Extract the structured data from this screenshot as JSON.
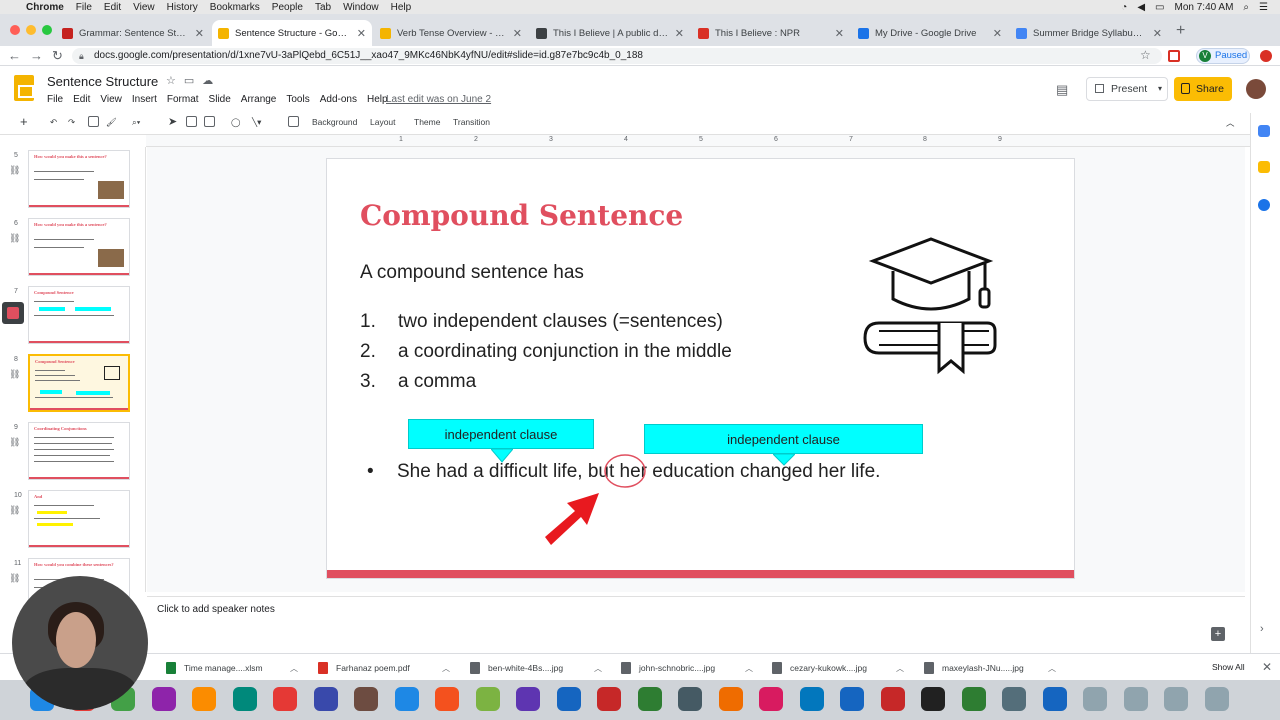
{
  "macbar": {
    "app_name": "Chrome",
    "menus": [
      "File",
      "Edit",
      "View",
      "History",
      "Bookmarks",
      "People",
      "Tab",
      "Window",
      "Help"
    ],
    "clock": "Mon 7:40 AM"
  },
  "tabs": [
    {
      "title": "Grammar: Sentence Structure",
      "color": "#c5221f"
    },
    {
      "title": "Sentence Structure - Google S",
      "color": "#f4b400"
    },
    {
      "title": "Verb Tense Overview - Google",
      "color": "#f4b400"
    },
    {
      "title": "This I Believe | A public dialog",
      "color": "#3c4043"
    },
    {
      "title": "This I Believe : NPR",
      "color": "#d93025"
    },
    {
      "title": "My Drive - Google Drive",
      "color": "#1a73e8"
    },
    {
      "title": "Summer Bridge Syllabus 2020",
      "color": "#4285f4"
    }
  ],
  "address": {
    "url": "docs.google.com/presentation/d/1xne7vU-3aPlQebd_6C51J__xao47_9MKc46NbK4yfNU/edit#slide=id.g87e7bc9c4b_0_188",
    "profile_letter": "V",
    "paused_label": "Paused"
  },
  "doc": {
    "title": "Sentence Structure",
    "menus": [
      "File",
      "Edit",
      "View",
      "Insert",
      "Format",
      "Slide",
      "Arrange",
      "Tools",
      "Add-ons",
      "Help"
    ],
    "last_edit": "Last edit was on June 2",
    "present_label": "Present",
    "share_label": "Share"
  },
  "toolbar": {
    "background": "Background",
    "layout": "Layout",
    "theme": "Theme",
    "transition": "Transition"
  },
  "ruler": [
    "1",
    "2",
    "3",
    "4",
    "5",
    "6",
    "7",
    "8",
    "9"
  ],
  "filmstrip": [
    {
      "num": "5",
      "title": "How would you make this a sentence?"
    },
    {
      "num": "6",
      "title": "How would you make this a sentence?"
    },
    {
      "num": "7",
      "title": "Compound Sentence"
    },
    {
      "num": "8",
      "title": "Compound Sentence"
    },
    {
      "num": "9",
      "title": "Coordinating Conjunctions"
    },
    {
      "num": "10",
      "title": "And"
    },
    {
      "num": "11",
      "title": "How would you combine these sentences?"
    }
  ],
  "slide": {
    "title": "Compound Sentence",
    "lead": "A compound sentence has",
    "items": [
      {
        "num": "1.",
        "text": "two independent clauses (=sentences)"
      },
      {
        "num": "2.",
        "text": "a coordinating conjunction in the middle"
      },
      {
        "num": "3.",
        "text": "a comma"
      }
    ],
    "clause_label_1": "independent clause",
    "clause_label_2": "independent clause",
    "sentence_bullet": "•",
    "sentence_part1": "She had a difficult life, ",
    "sentence_but": "but",
    "sentence_part2": " her education changed her life.",
    "accent_color": "#e04f5f"
  },
  "notes_placeholder": "Click to add speaker notes",
  "downloads": [
    {
      "name": "Time manage....xlsm",
      "color": "#188038"
    },
    {
      "name": "Farhanaz poem.pdf",
      "color": "#d93025"
    },
    {
      "name": "ben-white-4Bs....jpg",
      "color": "#5f6368"
    },
    {
      "name": "john-schnobric....jpg",
      "color": "#5f6368"
    },
    {
      "name": "cezary-kukowk....jpg",
      "color": "#5f6368"
    },
    {
      "name": "maxeylash-JNu.....jpg",
      "color": "#5f6368"
    }
  ],
  "show_all": "Show All",
  "dock": [
    "#1e88e5",
    "#e53935",
    "#43a047",
    "#8e24aa",
    "#fb8c00",
    "#00897b",
    "#e53935",
    "#3949ab",
    "#6d4c41",
    "#1e88e5",
    "#f4511e",
    "#7cb342",
    "#5e35b1",
    "#1565c0",
    "#c62828",
    "#2e7d32",
    "#455a64",
    "#ef6c00",
    "#d81b60",
    "#0277bd",
    "#1565c0",
    "#c62828",
    "#212121",
    "#2e7d32",
    "#546e7a",
    "#1565c0",
    "#90a4ae",
    "#90a4ae",
    "#90a4ae",
    "#90a4ae"
  ]
}
